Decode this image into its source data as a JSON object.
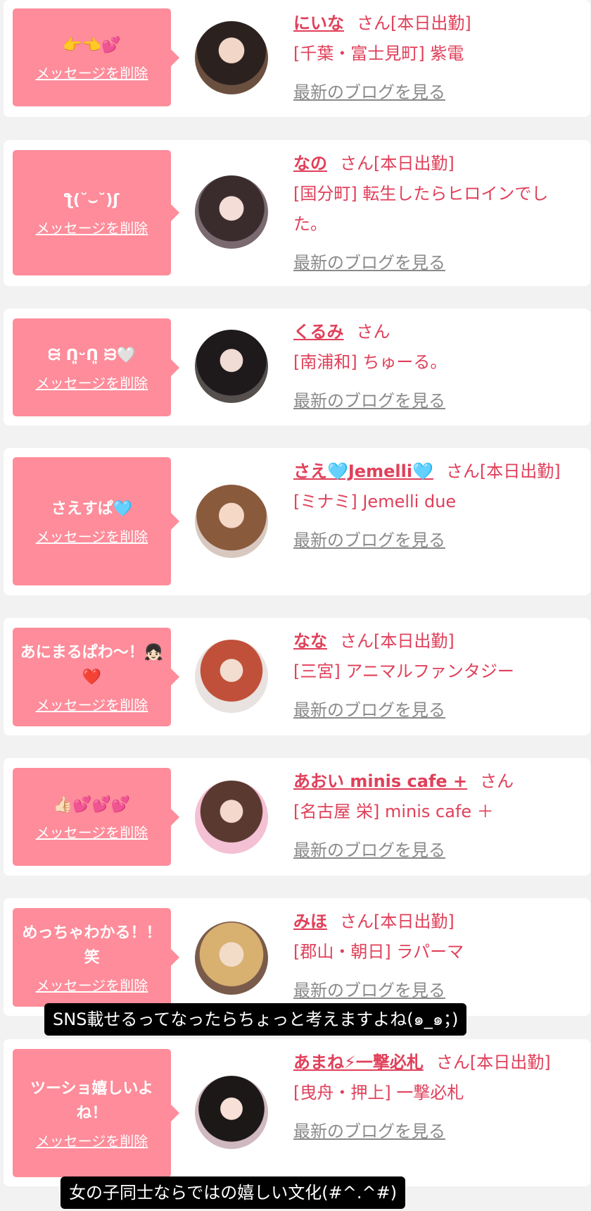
{
  "cards": [
    {
      "message": "👉👈💕",
      "delete_label": "メッセージを削除",
      "name": "にいな",
      "san": "さん[本日出勤]",
      "shop": "[千葉・富士見町] 紫電",
      "blog": "最新のブログを見る"
    },
    {
      "message": "ƪ(˘⌣˘)ʃ",
      "delete_label": "メッセージを削除",
      "name": "なの",
      "san": "さん[本日出勤]",
      "shop": "[国分町] 転生したらヒロインでした。",
      "blog": "最新のブログを見る"
    },
    {
      "message": "ᙦ ᑎ͈ᵕᑎ͈ ᙣ🤍",
      "delete_label": "メッセージを削除",
      "name": "くるみ",
      "san": "さん",
      "shop": "[南浦和] ちゅーる。",
      "blog": "最新のブログを見る"
    },
    {
      "message": "さえすぱ🩵",
      "delete_label": "メッセージを削除",
      "name": "さえ🩵Jemelli🩵",
      "san": "さん[本日出勤]",
      "shop": "[ミナミ] Jemelli due",
      "blog": "最新のブログを見る"
    },
    {
      "message": "あにまるぱわ～！👧🏻❤️",
      "delete_label": "メッセージを削除",
      "name": "なな",
      "san": "さん[本日出勤]",
      "shop": "[三宮] アニマルファンタジー",
      "blog": "最新のブログを見る"
    },
    {
      "message": "👍🏻💕💕💕",
      "delete_label": "メッセージを削除",
      "name": "あおい minis cafe +",
      "san": "さん",
      "shop": "[名古屋 栄] minis cafe ＋",
      "blog": "最新のブログを見る"
    },
    {
      "message": "めっちゃわかる！！笑",
      "delete_label": "メッセージを削除",
      "name": "みほ",
      "san": "さん[本日出勤]",
      "shop": "[郡山・朝日] ラパーマ",
      "blog": "最新のブログを見る"
    },
    {
      "message": "ツーショ嬉しいよね！",
      "delete_label": "メッセージを削除",
      "name": "あまね⚡一撃必札",
      "san": "さん[本日出勤]",
      "shop": "[曳舟・押上] 一撃必札",
      "blog": "最新のブログを見る"
    }
  ],
  "captions": {
    "caption1": "SNS載せるってなったらちょっと考えますよね(๑_๑；)",
    "caption2": "女の子同士ならではの嬉しい文化(#^.^#)"
  },
  "colors": {
    "bubble": "#fe8c9a",
    "name": "#e0405a",
    "blog": "#8a8a8a"
  }
}
